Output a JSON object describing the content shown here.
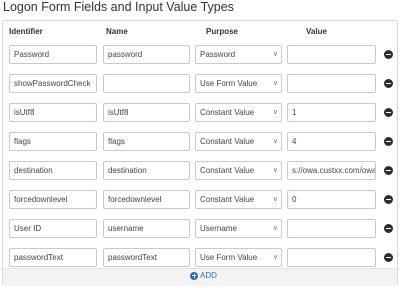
{
  "title": "Logon Form Fields and Input Value Types",
  "headers": {
    "identifier": "Identifier",
    "name": "Name",
    "purpose": "Purpose",
    "value": "Value"
  },
  "rows": [
    {
      "identifier": "Password",
      "name": "password",
      "purpose": "Password",
      "value": ""
    },
    {
      "identifier": "showPasswordCheck",
      "name": "",
      "purpose": "Use Form Value",
      "value": ""
    },
    {
      "identifier": "isUtf8",
      "name": "isUtf8",
      "purpose": "Constant Value",
      "value": "1"
    },
    {
      "identifier": "flags",
      "name": "flags",
      "purpose": "Constant Value",
      "value": "4"
    },
    {
      "identifier": "destination",
      "name": "destination",
      "purpose": "Constant Value",
      "value": "s://owa.custxx.com/owa"
    },
    {
      "identifier": "forcedownlevel",
      "name": "forcedownlevel",
      "purpose": "Constant Value",
      "value": "0"
    },
    {
      "identifier": "User ID",
      "name": "username",
      "purpose": "Username",
      "value": ""
    },
    {
      "identifier": "passwordText",
      "name": "passwordText",
      "purpose": "Use Form Value",
      "value": ""
    }
  ],
  "add_label": "ADD",
  "icons": {
    "remove": "minus-circle-icon",
    "add": "plus-circle-icon",
    "caret": "chevron-down-icon"
  },
  "colors": {
    "accent": "#2a6fb0",
    "border": "#c9c9c9"
  }
}
